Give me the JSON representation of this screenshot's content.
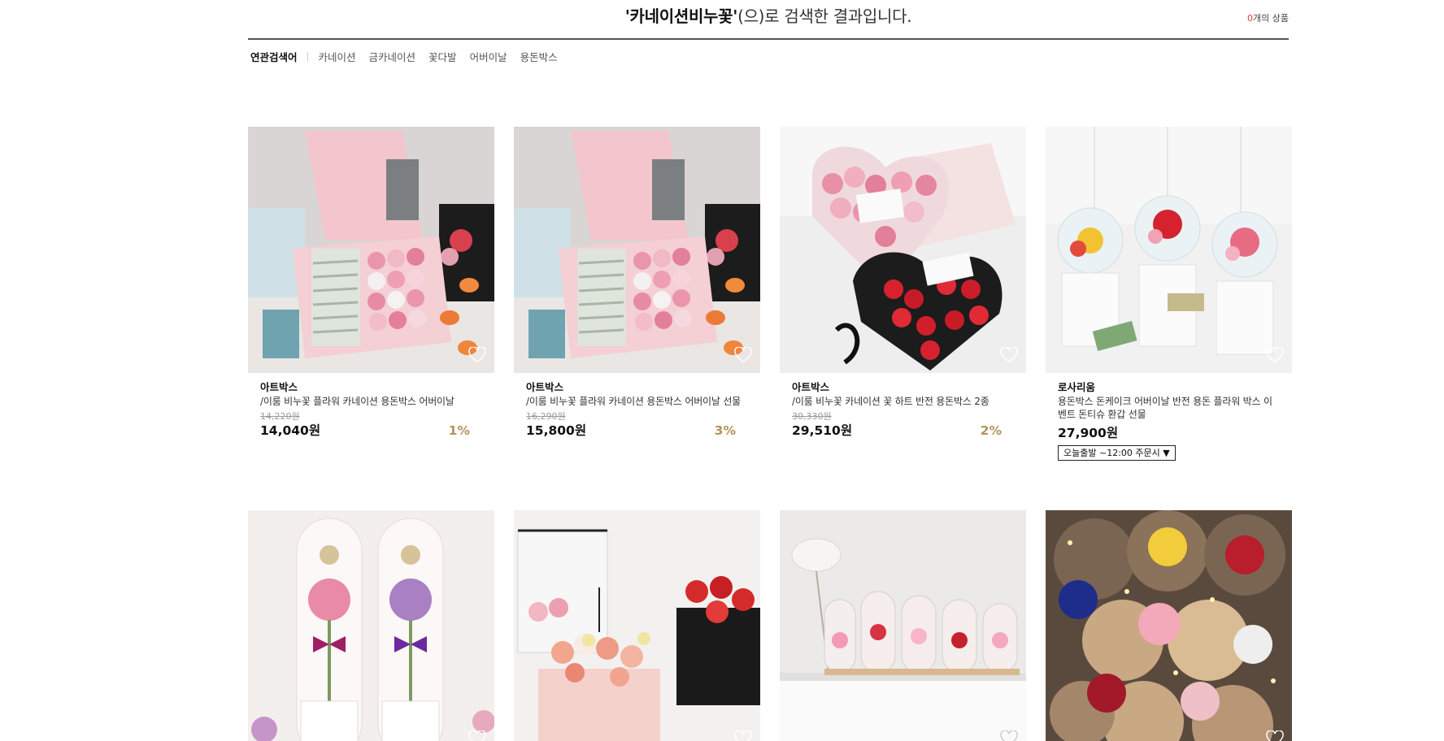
{
  "search": {
    "keyword": "'카네이션비누꽃'",
    "suffix": "(으)로 검색한 결과입니다.",
    "count": "0",
    "count_suffix": "개의 상품"
  },
  "related": {
    "label": "연관검색어",
    "keywords": [
      "카네이션",
      "금카네이션",
      "꽃다발",
      "어버이날",
      "용돈박스"
    ]
  },
  "products": [
    {
      "brand": "아트박스",
      "name": "/이룸 비누꽃 플라워 카네이션 용돈박스 어버이날",
      "original_price": "14,220원",
      "price": "14,040원",
      "discount": "1%",
      "image": "pink gift box with soap roses and rolled money"
    },
    {
      "brand": "아트박스",
      "name": "/이룸 비누꽃 플라워 카네이션 용돈박스 어버이날 선물",
      "original_price": "16,290원",
      "price": "15,800원",
      "discount": "3%",
      "image": "pink gift box with soap roses and rolled money"
    },
    {
      "brand": "아트박스",
      "name": "/이룸 비누꽃 카네이션 꽃 하트 반전 용돈박스 2종",
      "original_price": "30,330원",
      "price": "29,510원",
      "discount": "2%",
      "image": "heart shaped boxes with pink and red carnations"
    },
    {
      "brand": "로사리움",
      "name": "용돈박스 돈케이크 어버이날 반전 용돈 플라워 박스 이벤트 돈티슈 환갑 선물",
      "price": "27,900원",
      "shipping": "오늘출발 ~12:00 주문시 ▼",
      "image": "glass dome preserved flowers with money"
    },
    {
      "image": "single carnation stems in clear boxes"
    },
    {
      "image": "flower baskets with love picks"
    },
    {
      "image": "glass dome roses on white shelf"
    },
    {
      "image": "glowing dome preserved roses"
    }
  ],
  "colors": {
    "discount": "#b0945a",
    "count": "#e53935"
  }
}
